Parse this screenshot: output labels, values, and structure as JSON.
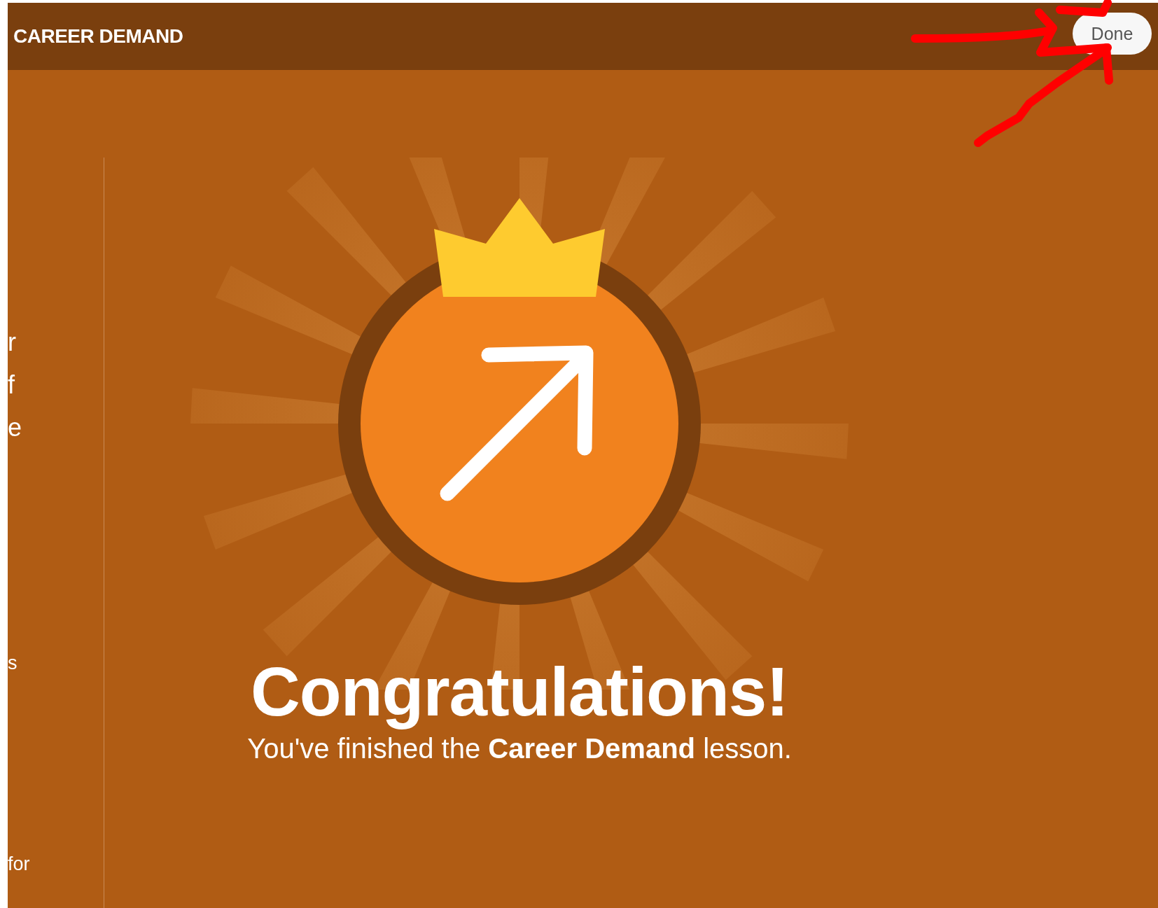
{
  "header": {
    "title": "CAREER DEMAND",
    "button": "Done"
  },
  "side_fragments": [
    {
      "text": "r",
      "kind": "large"
    },
    {
      "text": "f",
      "kind": "large"
    },
    {
      "text": "e",
      "kind": "large"
    },
    {
      "text": "s",
      "kind": "small"
    },
    {
      "text": "for",
      "kind": "small"
    }
  ],
  "completion": {
    "title": "Congratulations!",
    "message": "You've finished the **Career Demand** lesson."
  }
}
